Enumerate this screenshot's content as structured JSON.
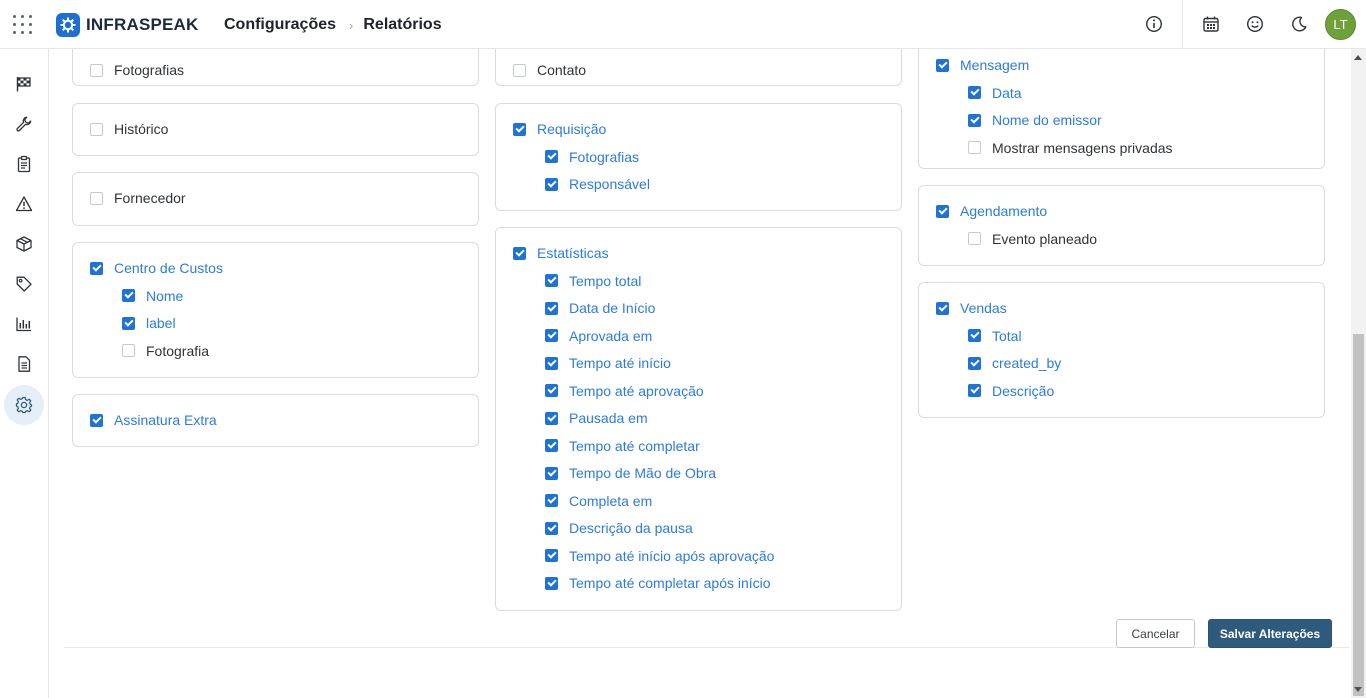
{
  "app": {
    "brand": "INFRASPEAK",
    "brand_color": "#1d6fd1"
  },
  "breadcrumb": {
    "level1": "Configurações",
    "sep": "›",
    "level2": "Relatórios"
  },
  "user": {
    "initials": "LT",
    "avatar_color": "#6fa13a"
  },
  "topbar": {
    "icons": [
      "info-icon",
      "calendar-icon",
      "smiley-icon",
      "moon-icon"
    ]
  },
  "sidebar": {
    "icons": [
      "flag-checkered-icon",
      "wrench-icon",
      "clipboard-icon",
      "warning-icon",
      "box-icon",
      "tag-icon",
      "bar-chart-icon",
      "document-icon",
      "gear-icon"
    ],
    "active": "gear-icon"
  },
  "columns": [
    {
      "cards": [
        {
          "items": [
            {
              "label": "Fotografias",
              "checked": false,
              "level": 0
            }
          ]
        },
        {
          "items": [
            {
              "label": "Histórico",
              "checked": false,
              "level": 0
            }
          ]
        },
        {
          "items": [
            {
              "label": "Fornecedor",
              "checked": false,
              "level": 0
            }
          ]
        },
        {
          "items": [
            {
              "label": "Centro de Custos",
              "checked": true,
              "level": 0
            },
            {
              "label": "Nome",
              "checked": true,
              "level": 1
            },
            {
              "label": "label",
              "checked": true,
              "level": 1
            },
            {
              "label": "Fotografia",
              "checked": false,
              "level": 1
            }
          ]
        },
        {
          "items": [
            {
              "label": "Assinatura Extra",
              "checked": true,
              "level": 0
            }
          ]
        }
      ]
    },
    {
      "cards": [
        {
          "items": [
            {
              "label": "Contato",
              "checked": false,
              "level": 0
            }
          ]
        },
        {
          "items": [
            {
              "label": "Requisição",
              "checked": true,
              "level": 0
            },
            {
              "label": "Fotografias",
              "checked": true,
              "level": 1
            },
            {
              "label": "Responsável",
              "checked": true,
              "level": 1
            }
          ]
        },
        {
          "items": [
            {
              "label": "Estatísticas",
              "checked": true,
              "level": 0
            },
            {
              "label": "Tempo total",
              "checked": true,
              "level": 1
            },
            {
              "label": "Data de Início",
              "checked": true,
              "level": 1
            },
            {
              "label": "Aprovada em",
              "checked": true,
              "level": 1
            },
            {
              "label": "Tempo até início",
              "checked": true,
              "level": 1
            },
            {
              "label": "Tempo até aprovação",
              "checked": true,
              "level": 1
            },
            {
              "label": "Pausada em",
              "checked": true,
              "level": 1
            },
            {
              "label": "Tempo até completar",
              "checked": true,
              "level": 1
            },
            {
              "label": "Tempo de Mão de Obra",
              "checked": true,
              "level": 1
            },
            {
              "label": "Completa em",
              "checked": true,
              "level": 1
            },
            {
              "label": "Descrição da pausa",
              "checked": true,
              "level": 1
            },
            {
              "label": "Tempo até início após aprovação",
              "checked": true,
              "level": 1
            },
            {
              "label": "Tempo até completar após início",
              "checked": true,
              "level": 1
            }
          ]
        }
      ]
    },
    {
      "cards": [
        {
          "items": [
            {
              "label": "Mensagem",
              "checked": true,
              "level": 0
            },
            {
              "label": "Data",
              "checked": true,
              "level": 1
            },
            {
              "label": "Nome do emissor",
              "checked": true,
              "level": 1
            },
            {
              "label": "Mostrar mensagens privadas",
              "checked": false,
              "level": 1
            }
          ]
        },
        {
          "items": [
            {
              "label": "Agendamento",
              "checked": true,
              "level": 0
            },
            {
              "label": "Evento planeado",
              "checked": false,
              "level": 1
            }
          ]
        },
        {
          "items": [
            {
              "label": "Vendas",
              "checked": true,
              "level": 0
            },
            {
              "label": "Total",
              "checked": true,
              "level": 1
            },
            {
              "label": "created_by",
              "checked": true,
              "level": 1
            },
            {
              "label": "Descrição",
              "checked": true,
              "level": 1
            }
          ]
        }
      ]
    }
  ],
  "actions": {
    "cancel_label": "Cancelar",
    "save_label": "Salvar Alterações"
  },
  "colors": {
    "checked_text": "#2c7be0",
    "checkbox_on": "#1f73d6",
    "save_button": "#2e5a7c"
  }
}
